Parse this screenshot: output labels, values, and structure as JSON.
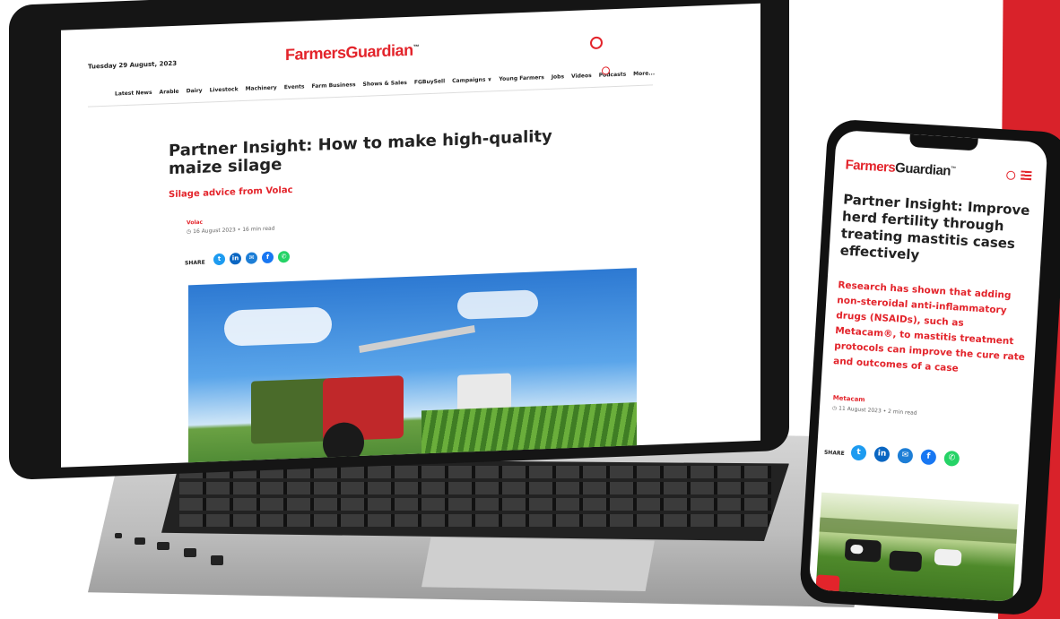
{
  "brand": {
    "logo_part1": "Farmers",
    "logo_part2": "Guardian",
    "trademark": "™",
    "red": "#e3242b",
    "accent_stripe": "#d9222a"
  },
  "laptop": {
    "date": "Tuesday 29 August, 2023",
    "nav": [
      "Latest News",
      "Arable",
      "Dairy",
      "Livestock",
      "Machinery",
      "Events",
      "Farm Business",
      "Shows & Sales",
      "FGBuySell",
      "Campaigns ∨",
      "Young Farmers",
      "Jobs",
      "Videos",
      "Podcasts",
      "More..."
    ],
    "article": {
      "title": "Partner Insight: How to make high-quality maize silage",
      "subtitle": "Silage advice from Volac",
      "author": "Volac",
      "meta": "16 August 2023 • 16 min read",
      "share_label": "SHARE"
    }
  },
  "phone": {
    "article": {
      "title": "Partner Insight: Improve herd fertility through treating mastitis cases effectively",
      "subtitle": "Research has shown that adding non-steroidal anti-inflammatory drugs (NSAIDs), such as Metacam®, to mastitis treatment protocols can improve the cure rate and outcomes of a case",
      "author": "Metacam",
      "meta": "11 August 2023 • 2 min read",
      "share_label": "SHARE"
    }
  },
  "share_icons": [
    {
      "name": "twitter-icon",
      "glyph": "t",
      "color": "#1d9bf0"
    },
    {
      "name": "linkedin-icon",
      "glyph": "in",
      "color": "#0a66c2"
    },
    {
      "name": "email-icon",
      "glyph": "✉",
      "color": "#1d7ed6"
    },
    {
      "name": "facebook-icon",
      "glyph": "f",
      "color": "#1877f2"
    },
    {
      "name": "whatsapp-icon",
      "glyph": "✆",
      "color": "#25d366"
    }
  ]
}
